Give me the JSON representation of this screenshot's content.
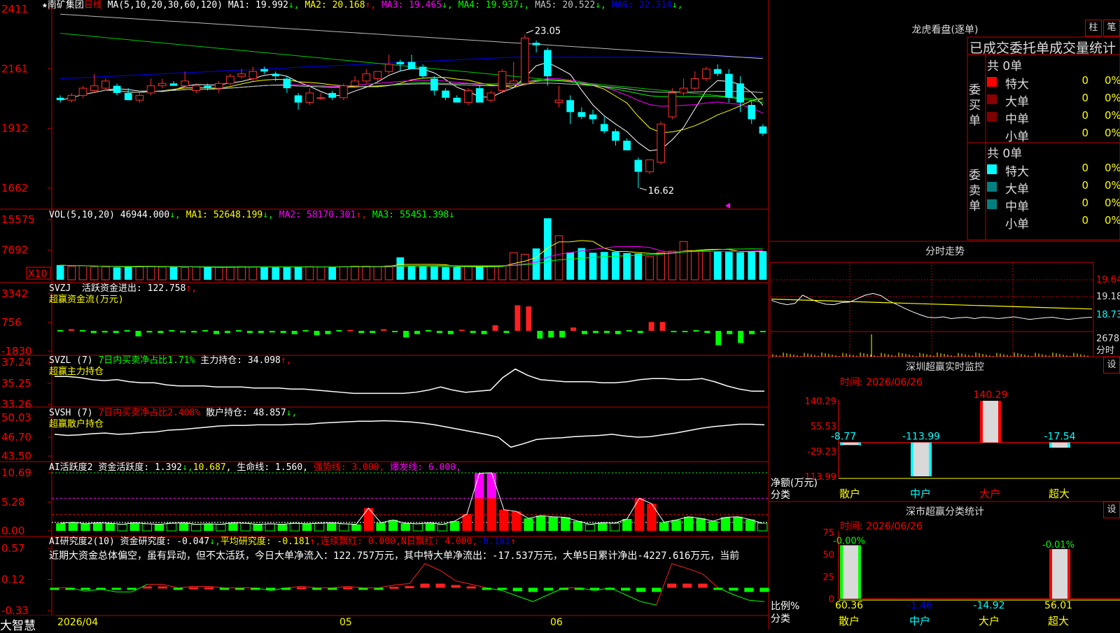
{
  "app": {
    "brand": "大智慧",
    "period_date": "2026/04",
    "month_05": "05",
    "month_06": "06"
  },
  "stock": {
    "name": "南矿集团",
    "period": "日线",
    "ma_label": "MA(5,10,20,30,60,120)"
  },
  "ma_legend": [
    {
      "label": "MA1: 19.992",
      "arrow": "↓",
      "color": "#ffffff"
    },
    {
      "label": "MA2: 20.168",
      "arrow": "↑",
      "color": "#ffff00"
    },
    {
      "label": "MA3: 19.465",
      "arrow": "↓",
      "color": "#ff00ff"
    },
    {
      "label": "MA4: 19.937",
      "arrow": "↓",
      "color": "#00ff00"
    },
    {
      "label": "MA5: 20.522",
      "arrow": "↓",
      "color": "#c0c0c0"
    },
    {
      "label": "MA6: 22.314",
      "arrow": "↓",
      "color": "#0000ff"
    }
  ],
  "price_axis": [
    "2411",
    "2161",
    "1912",
    "1662"
  ],
  "price_annotations": {
    "high": "23.05",
    "low": "16.62"
  },
  "vol": {
    "label": "VOL(5,10,20)",
    "value": "46944.000",
    "ma1": "MA1: 52648.199",
    "ma2": "MA2: 58170.301",
    "ma3": "MA3: 55451.398",
    "axis": [
      "15575",
      "7692"
    ],
    "unit": "X10"
  },
  "svzj": {
    "label": "SVZJ  活跃资金进出: 122.758",
    "sub": "超赢资金流(万元)",
    "axis": [
      "3342",
      "756",
      "-1830"
    ]
  },
  "svzl": {
    "label": "SVZL (7)",
    "l2": "7日内买卖净占比1.71%",
    "l3": "主力持仓: 34.098",
    "sub": "超赢主力持仓",
    "axis": [
      "37.24",
      "35.25",
      "33.26"
    ]
  },
  "svsh": {
    "label": "SVSH (7)",
    "l2": "7日内买卖净占比2.408%",
    "l3": "散户持仓: 48.857",
    "sub": "超赢散户持仓",
    "axis": [
      "50.03",
      "46.70",
      "43.50"
    ]
  },
  "ai1": {
    "label": "AI活跃度2",
    "l2": "资金活跃度: 1.392",
    "l3": "10.687",
    "l4": "生命线: 1.560",
    "l5": "强势线: 3.000",
    "l6": "爆发线: 6.000",
    "axis": [
      "10.69",
      "5.28",
      "0.00"
    ]
  },
  "ai2": {
    "label": "AI研究度2(10)",
    "l2": "资金研究度: -0.047",
    "l3": "平均研究度: -0.181",
    "l4": "连续飘红: 0.000",
    "l5": "N日飘红: 4.000",
    "l6": "-0.181",
    "text": "近期大资金总体偏空，虽有异动，但不太活跃，今日大单净流入：122.757万元，其中特大单净流出：-17.537万元，大单5日累计净出-4227.616万元，当前",
    "axis": [
      "0.57",
      "0.12",
      "-0.33"
    ]
  },
  "right": {
    "title": "龙虎看盘(逐单)",
    "btn1": "柱",
    "btn2": "笔",
    "stats_title": "已成交委托单成交量统计",
    "buy": {
      "label": "委买单",
      "total": "共 0单"
    },
    "sell": {
      "label": "委卖单",
      "total": "共 0单"
    },
    "rows": [
      {
        "name": "特大",
        "v": "0",
        "p": "0%"
      },
      {
        "name": "大单",
        "v": "0",
        "p": "0%"
      },
      {
        "name": "中单",
        "v": "0",
        "p": "0%"
      },
      {
        "name": "小单",
        "v": "0",
        "p": "0%"
      }
    ],
    "intraday_title": "分时走势",
    "intraday_axis": [
      "19.64",
      "19.18",
      "18.73",
      "2678",
      "分时"
    ],
    "sz_title": "深圳超赢实时监控",
    "sz_time": "时间: 2026/06/26",
    "sz_axis": [
      "140.29",
      "55.53",
      "-29.23",
      "-113.99"
    ],
    "sz_ylabel": "净额(万元)",
    "sz_xlabel": "分类",
    "sz_set": "设",
    "cls_title": "深市超赢分类统计",
    "cls_time": "时间: 2026/06/26",
    "cls_axis": [
      "75",
      "50",
      "25",
      "0"
    ],
    "cls_ylabel": "比例%",
    "cls_xlabel": "分类",
    "cls_set": "设"
  },
  "chart_data": [
    {
      "type": "candlestick",
      "title": "南矿集团 日线",
      "ylim": [
        16.0,
        24.2
      ],
      "x_axis_ticks": [
        "2026/04",
        "05",
        "06"
      ],
      "candles": [
        [
          20.4,
          20.5,
          20.2,
          20.3
        ],
        [
          20.3,
          20.6,
          20.2,
          20.5
        ],
        [
          20.5,
          20.9,
          20.4,
          20.8
        ],
        [
          20.7,
          21.4,
          20.6,
          20.9
        ],
        [
          20.8,
          21.2,
          20.7,
          21.1
        ],
        [
          20.9,
          21.0,
          20.5,
          20.6
        ],
        [
          20.6,
          20.8,
          20.3,
          20.3
        ],
        [
          20.3,
          20.6,
          20.2,
          20.5
        ],
        [
          20.6,
          21.2,
          20.5,
          20.9
        ],
        [
          20.9,
          21.2,
          20.8,
          21.0
        ],
        [
          21.0,
          21.1,
          20.9,
          20.9
        ],
        [
          20.9,
          21.5,
          20.8,
          21.1
        ],
        [
          20.7,
          21.0,
          20.6,
          20.9
        ],
        [
          20.9,
          21.0,
          20.7,
          20.8
        ],
        [
          20.8,
          21.1,
          20.6,
          21.0
        ],
        [
          21.0,
          21.4,
          20.9,
          21.3
        ],
        [
          21.3,
          21.6,
          21.2,
          21.4
        ],
        [
          21.2,
          21.7,
          21.1,
          21.5
        ],
        [
          21.6,
          21.7,
          21.4,
          21.5
        ],
        [
          21.4,
          21.5,
          21.1,
          21.3
        ],
        [
          21.2,
          21.3,
          20.6,
          20.8
        ],
        [
          20.5,
          20.6,
          19.9,
          20.2
        ],
        [
          20.2,
          20.8,
          20.1,
          20.6
        ],
        [
          20.4,
          20.6,
          20.3,
          20.4
        ],
        [
          20.6,
          20.7,
          20.3,
          20.4
        ],
        [
          20.4,
          21.0,
          20.3,
          20.9
        ],
        [
          20.9,
          21.3,
          20.8,
          21.1
        ],
        [
          21.1,
          21.6,
          21.0,
          21.4
        ],
        [
          21.2,
          21.5,
          21.0,
          21.5
        ],
        [
          21.5,
          22.2,
          21.4,
          21.8
        ],
        [
          21.9,
          22.0,
          21.5,
          21.8
        ],
        [
          21.9,
          22.2,
          21.6,
          21.6
        ],
        [
          21.7,
          21.8,
          21.2,
          21.3
        ],
        [
          21.2,
          21.3,
          20.5,
          20.7
        ],
        [
          20.7,
          20.8,
          20.3,
          20.4
        ],
        [
          20.4,
          20.5,
          20.2,
          20.2
        ],
        [
          20.2,
          20.8,
          20.1,
          20.7
        ],
        [
          20.8,
          20.9,
          20.2,
          20.2
        ],
        [
          20.3,
          20.7,
          20.2,
          20.6
        ],
        [
          20.7,
          21.6,
          20.6,
          21.5
        ],
        [
          21.0,
          21.9,
          20.9,
          21.1
        ],
        [
          21.0,
          23.05,
          20.9,
          22.9
        ],
        [
          22.7,
          22.8,
          22.3,
          22.6
        ],
        [
          22.4,
          22.5,
          20.9,
          21.3
        ],
        [
          20.2,
          20.9,
          20.0,
          20.3
        ],
        [
          20.3,
          20.5,
          19.3,
          19.8
        ],
        [
          19.8,
          20.0,
          19.5,
          19.6
        ],
        [
          19.7,
          19.9,
          19.3,
          19.5
        ],
        [
          19.3,
          19.6,
          18.9,
          19.0
        ],
        [
          19.0,
          19.1,
          18.4,
          18.6
        ],
        [
          18.6,
          18.7,
          18.2,
          18.2
        ],
        [
          17.8,
          17.9,
          16.62,
          17.3
        ],
        [
          17.3,
          17.8,
          17.2,
          17.8
        ],
        [
          17.7,
          19.4,
          17.6,
          19.3
        ],
        [
          19.6,
          20.8,
          19.5,
          20.6
        ],
        [
          20.6,
          21.2,
          20.5,
          20.8
        ],
        [
          20.8,
          21.5,
          20.7,
          21.2
        ],
        [
          21.2,
          21.7,
          21.1,
          21.6
        ],
        [
          21.6,
          21.8,
          21.3,
          21.4
        ],
        [
          21.4,
          21.6,
          20.2,
          20.4
        ],
        [
          21.0,
          21.3,
          19.8,
          20.2
        ],
        [
          20.1,
          20.3,
          19.3,
          19.5
        ],
        [
          19.2,
          19.3,
          18.8,
          18.9
        ]
      ],
      "ma_series": [
        {
          "name": "MA1",
          "color": "#ffffff",
          "value": 19.992
        },
        {
          "name": "MA2",
          "color": "#ffff00",
          "value": 20.168
        },
        {
          "name": "MA3",
          "color": "#ff00ff",
          "value": 19.465
        },
        {
          "name": "MA4",
          "color": "#00ff00",
          "value": 19.937
        },
        {
          "name": "MA5",
          "color": "#c0c0c0",
          "value": 20.522
        },
        {
          "name": "MA6",
          "color": "#0000ff",
          "value": 22.314
        }
      ]
    },
    {
      "type": "bar",
      "title": "VOL(5,10,20)",
      "ylim": [
        0,
        17000
      ],
      "unit": "X10",
      "values": [
        3800,
        3500,
        3600,
        3300,
        3300,
        3200,
        3400,
        3500,
        3500,
        3300,
        3300,
        3200,
        3300,
        3200,
        3200,
        3300,
        3400,
        3300,
        3300,
        3300,
        3300,
        3400,
        3400,
        3300,
        3300,
        3400,
        3500,
        3500,
        3400,
        3600,
        5800,
        3600,
        3500,
        3400,
        3300,
        3300,
        3400,
        3400,
        3500,
        3600,
        7000,
        6600,
        8100,
        15900,
        11400,
        7100,
        8200,
        7000,
        7200,
        7200,
        6900,
        6800,
        6000,
        7100,
        7400,
        9900,
        7300,
        7400,
        7400,
        7200,
        7100,
        7300,
        7400
      ]
    },
    {
      "type": "bar",
      "title": "超赢资金流(万元)",
      "ylim": [
        -1830,
        3342
      ],
      "values": [
        0,
        150,
        0,
        -200,
        -150,
        -200,
        0,
        -500,
        -150,
        -200,
        0,
        -150,
        -150,
        0,
        -300,
        -200,
        0,
        -200,
        -200,
        -150,
        -200,
        -300,
        0,
        -400,
        -300,
        0,
        80,
        -200,
        -200,
        150,
        -100,
        -600,
        -300,
        0,
        -200,
        -300,
        100,
        -200,
        -300,
        500,
        -200,
        2300,
        2200,
        -700,
        -600,
        -600,
        300,
        -300,
        -200,
        -200,
        -300,
        0,
        -200,
        800,
        800,
        -100,
        -100,
        0,
        -200,
        -1300,
        -300,
        -1100,
        -300,
        -100
      ]
    },
    {
      "type": "line",
      "title": "超赢主力持仓",
      "ylim": [
        33.26,
        37.24
      ],
      "values": [
        35.9,
        35.9,
        35.8,
        35.6,
        35.5,
        35.6,
        35.4,
        35.3,
        35.3,
        35.1,
        35.0,
        35.0,
        35.0,
        34.9,
        34.9,
        34.9,
        34.8,
        34.8,
        34.8,
        34.7,
        34.7,
        34.6,
        34.5,
        34.4,
        34.3,
        34.3,
        34.3,
        34.3,
        34.3,
        34.4,
        34.6,
        34.9,
        34.6,
        34.4,
        34.5,
        34.6,
        35.8,
        36.6,
        36.0,
        35.6,
        35.5,
        35.4,
        35.4,
        35.4,
        35.3,
        35.3,
        35.4,
        35.6,
        35.7,
        35.7,
        35.6,
        35.6,
        35.7,
        35.4,
        35.0,
        34.7,
        34.5,
        34.5
      ]
    },
    {
      "type": "line",
      "title": "超赢散户持仓",
      "ylim": [
        43.5,
        50.03
      ],
      "values": [
        47.2,
        47.0,
        47.1,
        47.3,
        47.4,
        47.2,
        47.3,
        47.5,
        47.6,
        47.9,
        48.0,
        48.2,
        48.4,
        48.6,
        48.7,
        48.7,
        48.8,
        48.8,
        48.8,
        48.9,
        48.9,
        49.1,
        49.2,
        49.3,
        49.4,
        49.4,
        49.5,
        49.4,
        49.3,
        49.1,
        48.8,
        48.4,
        48.0,
        47.6,
        47.2,
        46.7,
        45.0,
        45.6,
        46.3,
        46.5,
        46.6,
        46.8,
        46.9,
        47.0,
        47.2,
        46.9,
        46.7,
        46.8,
        47.1,
        47.4,
        47.8,
        48.2,
        48.5,
        48.7,
        48.9,
        48.9,
        48.8
      ]
    },
    {
      "type": "bar",
      "title": "AI活跃度2",
      "ylim": [
        0,
        10.69
      ],
      "values": [
        1.4,
        1.6,
        1.3,
        1.5,
        1.4,
        1.2,
        1.5,
        1.3,
        1.2,
        1.4,
        1.5,
        1.2,
        1.3,
        1.2,
        1.5,
        1.4,
        1.2,
        1.3,
        1.2,
        1.4,
        1.3,
        1.4,
        1.5,
        1.3,
        1.2,
        4.2,
        1.5,
        2.0,
        1.4,
        1.3,
        1.5,
        1.2,
        1.8,
        3.1,
        10.6,
        10.7,
        3.9,
        3.6,
        2.3,
        2.8,
        2.6,
        2.5,
        1.8,
        1.2,
        1.5,
        1.4,
        2.2,
        6.0,
        5.0,
        1.6,
        2.0,
        2.6,
        2.3,
        1.8,
        2.5,
        2.6,
        2.1,
        1.4
      ]
    },
    {
      "type": "line",
      "title": "AI研究度2(10)",
      "ylim": [
        -0.33,
        0.57
      ],
      "values": [
        0.0,
        0.0,
        -0.05,
        -0.02,
        -0.06,
        -0.06,
        0.05,
        0.05,
        0.0,
        0.02,
        0.02,
        0.0,
        0.0,
        0.0,
        -0.04,
        0.0,
        0.02,
        0.0,
        0.0,
        0.02,
        0.0,
        0.0,
        0.04,
        0.06,
        0.35,
        0.25,
        0.1,
        0.05,
        0.0,
        -0.04,
        -0.12,
        -0.2,
        -0.1,
        0.0,
        0.0,
        -0.04,
        0.0,
        -0.1,
        -0.2,
        -0.25,
        0.35,
        0.28,
        0.2,
        0.0,
        -0.1,
        -0.18,
        -0.2
      ]
    },
    {
      "type": "line",
      "title": "分时走势",
      "ylim": [
        18.3,
        19.9
      ],
      "values": [
        19.02,
        18.96,
        18.92,
        18.95,
        19.14,
        19.05,
        18.98,
        18.93,
        18.92,
        18.97,
        18.98,
        19.06,
        19.14,
        19.18,
        19.13,
        19.01,
        18.93,
        18.84,
        18.76,
        18.69,
        18.63,
        18.62,
        18.64,
        18.6,
        18.62,
        18.63,
        18.6,
        18.63,
        18.62,
        18.6,
        18.62,
        18.64,
        18.61,
        18.58,
        18.6,
        18.62,
        18.63,
        18.6,
        18.58,
        18.6,
        18.62,
        18.63
      ]
    },
    {
      "type": "bar",
      "title": "深圳超赢实时监控",
      "categories": [
        "散户",
        "中户",
        "大户",
        "超大"
      ],
      "values": [
        -8.77,
        -113.99,
        140.29,
        -17.54
      ],
      "ylim": [
        -113.99,
        140.29
      ]
    },
    {
      "type": "bar",
      "title": "深市超赢分类统计",
      "categories": [
        "散户",
        "中户",
        "大户",
        "超大"
      ],
      "values": [
        60.36,
        -1.46,
        -14.92,
        56.01
      ],
      "labels_top": [
        "-0.00%",
        "",
        "",
        "-0.01%"
      ],
      "ylim": [
        0,
        75
      ]
    }
  ]
}
